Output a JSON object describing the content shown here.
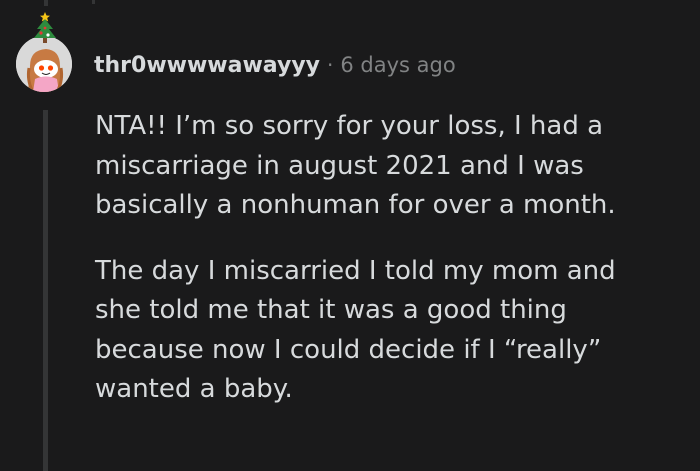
{
  "comment": {
    "username": "thr0wwwwawayyy",
    "separator": "·",
    "timestamp": "6 days ago",
    "paragraphs": [
      "NTA!! I’m so sorry for your loss, I had a\nmiscarriage in august 2021 and I was\nbasically a nonhuman for over a month.",
      "The day I miscarried I told my mom and\nshe told me that it was a good thing\nbecause now I could decide if I “really”\nwanted a baby."
    ],
    "avatar_icon": "snoo-avatar-icon",
    "avatar_accessory_icon": "christmas-tree-icon"
  },
  "colors": {
    "background": "#1a1a1b",
    "text": "#d7dadc",
    "meta": "#818384",
    "thread_line": "#343536"
  }
}
